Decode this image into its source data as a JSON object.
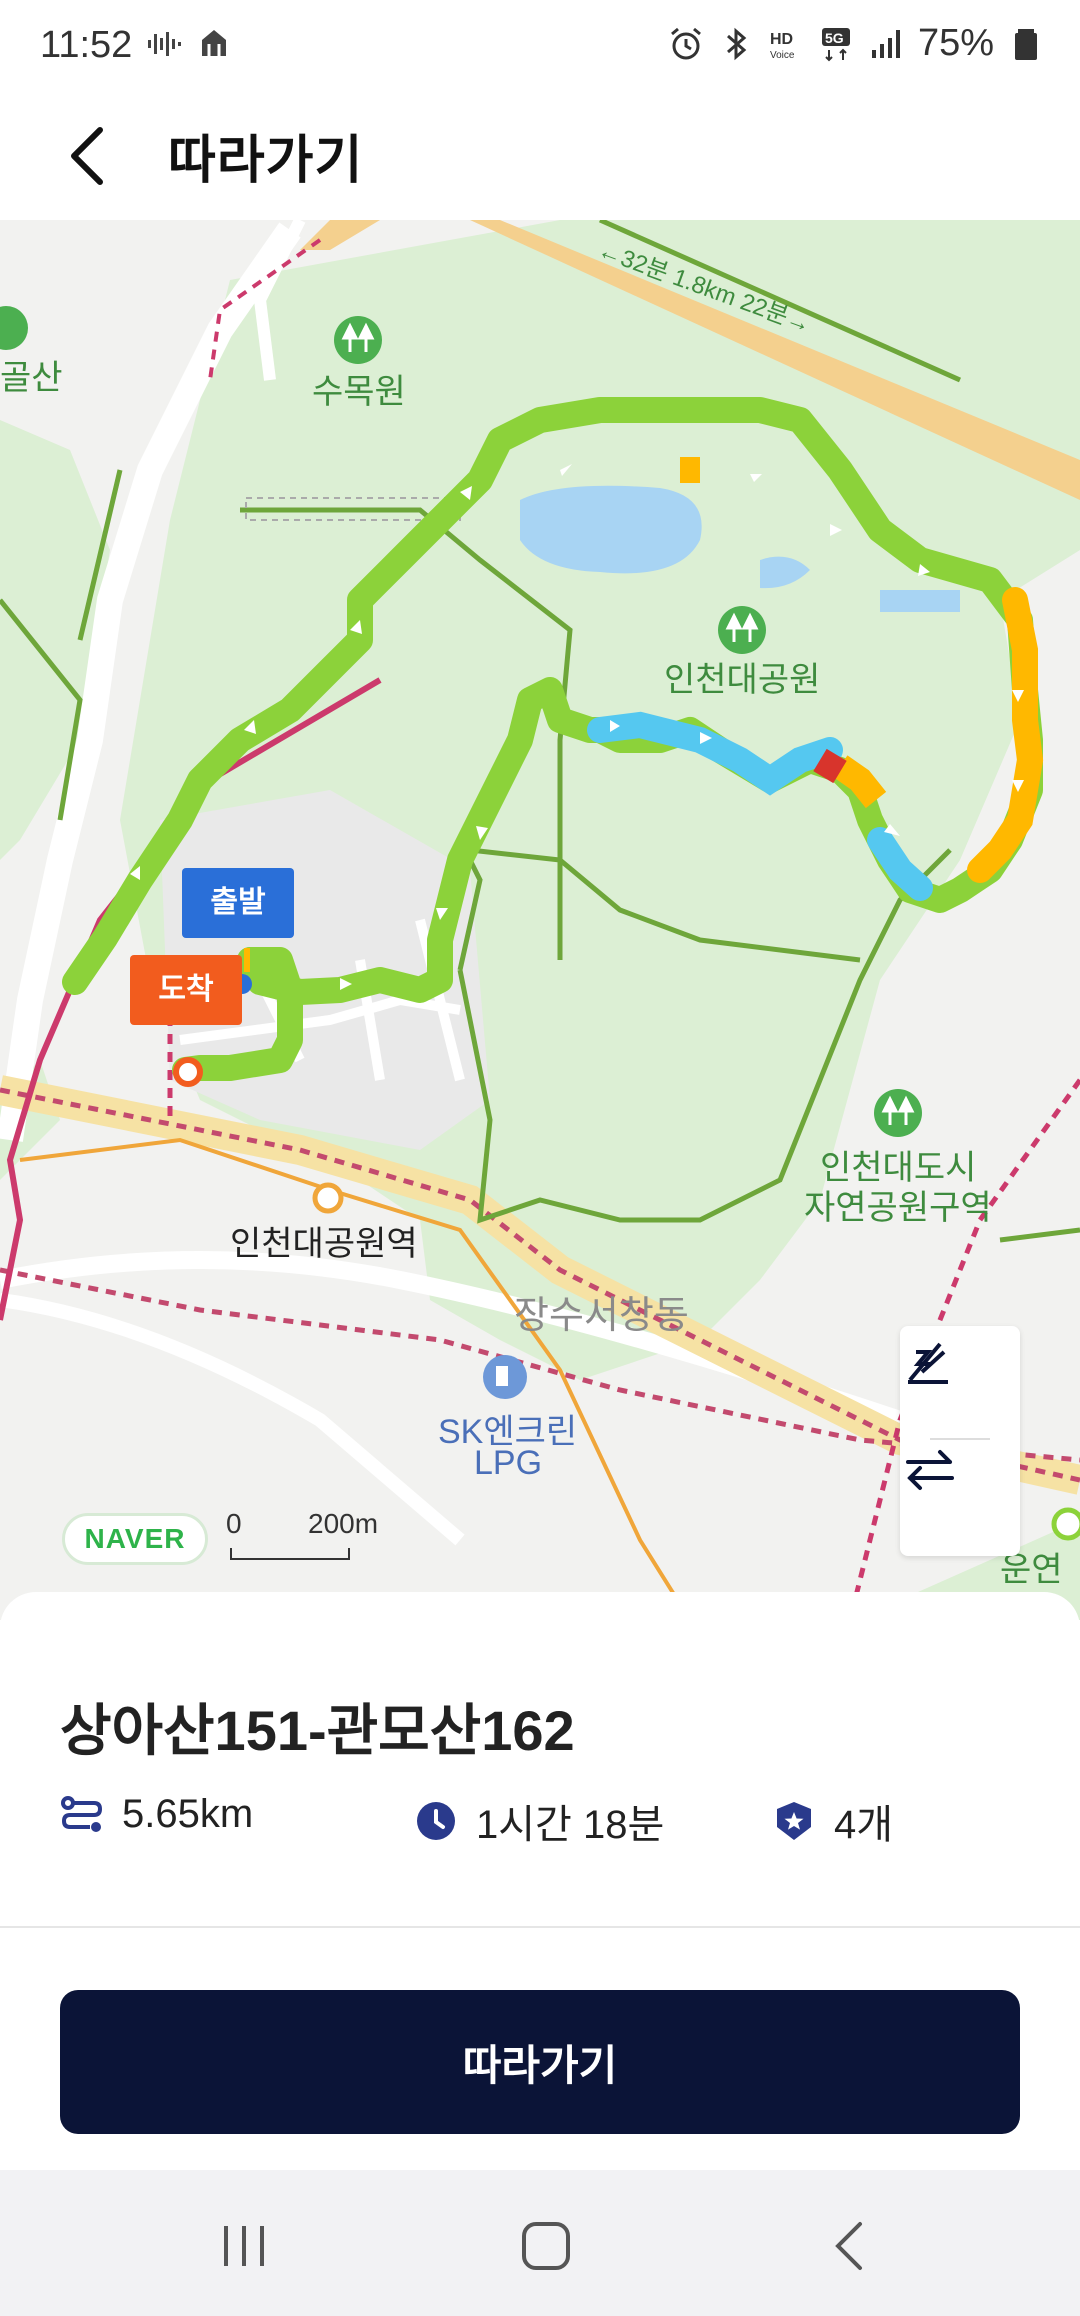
{
  "status_bar": {
    "time": "11:52",
    "battery": "75%",
    "icons": [
      "voice-wave-icon",
      "data-transfer-icon",
      "alarm-icon",
      "bluetooth-icon",
      "hd-voice-icon",
      "5g-icon",
      "signal-icon",
      "battery-icon"
    ]
  },
  "header": {
    "title": "따라가기",
    "back_icon": "chevron-left-icon"
  },
  "map": {
    "labels": {
      "arboretum": "수목원",
      "park": "인천대공원",
      "park_station": "인천대공원역",
      "district": "장수서창동",
      "nature_zone_line1": "인천대도시",
      "nature_zone_line2": "자연공원구역",
      "gas_station_line1": "SK엔크린",
      "gas_station_line2": "LPG",
      "left_mountain": "골산",
      "right_edge": "운연동",
      "trail_info": "←32분 1.8km 22분→"
    },
    "start_pin": "출발",
    "end_pin": "도착",
    "provider": "NAVER",
    "scale": {
      "zero": "0",
      "distance": "200m"
    },
    "controls": [
      "elevation-toggle-icon",
      "swap-direction-icon"
    ],
    "colors": {
      "route_green": "#8cd23a",
      "route_blue": "#55c8f0",
      "route_orange": "#ffb800",
      "route_red": "#d8342c"
    }
  },
  "route": {
    "name": "상아산151-관모산162",
    "distance": "5.65km",
    "duration": "1시간 18분",
    "badges": "4개"
  },
  "follow_button": "따라가기",
  "nav_bar": [
    "recent-apps-icon",
    "home-icon",
    "back-icon"
  ],
  "accent_color": "#0b1437"
}
